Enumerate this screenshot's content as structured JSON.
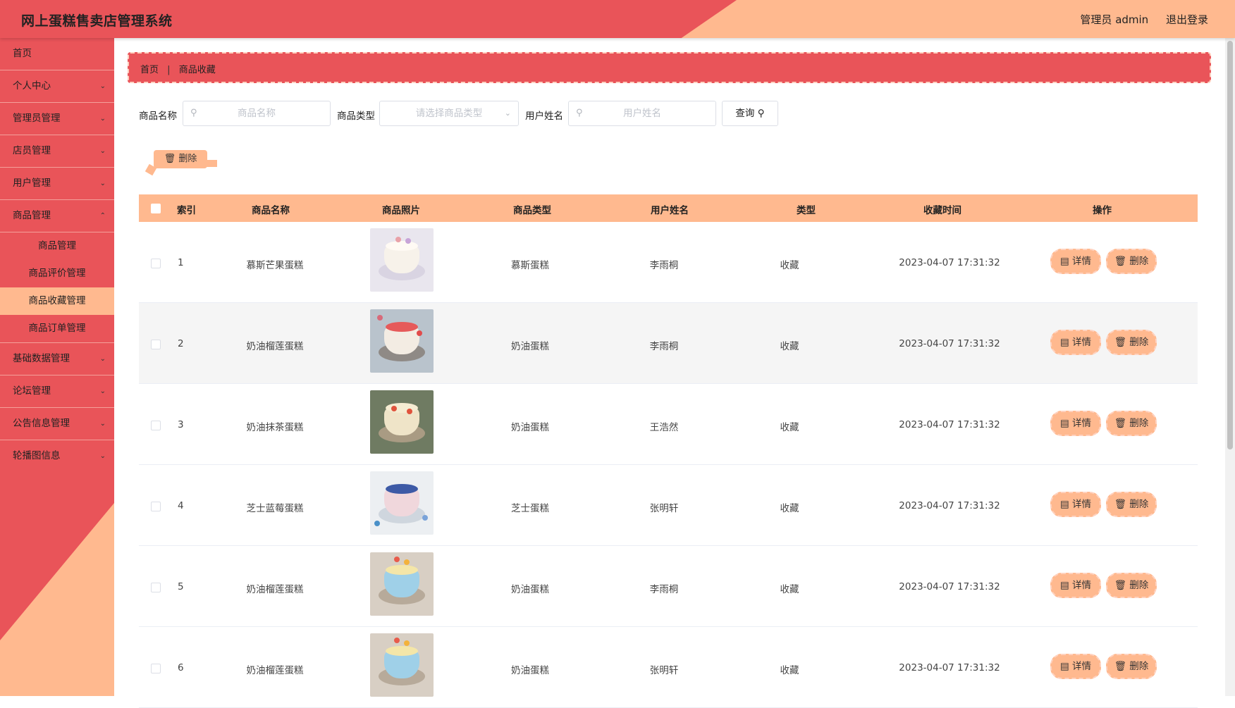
{
  "header": {
    "title": "网上蛋糕售卖店管理系统",
    "user": "管理员 admin",
    "logout": "退出登录"
  },
  "sidebar": {
    "items": [
      {
        "label": "首页"
      },
      {
        "label": "个人中心"
      },
      {
        "label": "管理员管理"
      },
      {
        "label": "店员管理"
      },
      {
        "label": "用户管理"
      },
      {
        "label": "商品管理"
      }
    ],
    "sub_items": [
      {
        "label": "商品管理"
      },
      {
        "label": "商品评价管理"
      },
      {
        "label": "商品收藏管理"
      },
      {
        "label": "商品订单管理"
      }
    ],
    "items_after": [
      {
        "label": "基础数据管理"
      },
      {
        "label": "论坛管理"
      },
      {
        "label": "公告信息管理"
      },
      {
        "label": "轮播图信息"
      }
    ],
    "active_sub": "商品收藏管理"
  },
  "breadcrumb": {
    "home": "首页",
    "current": "商品收藏"
  },
  "search": {
    "name_label": "商品名称",
    "name_placeholder": "商品名称",
    "type_label": "商品类型",
    "type_placeholder": "请选择商品类型",
    "user_label": "用户姓名",
    "user_placeholder": "用户姓名",
    "query": "查询"
  },
  "bulk_delete": "删除",
  "table": {
    "headers": [
      "索引",
      "商品名称",
      "商品照片",
      "商品类型",
      "用户姓名",
      "类型",
      "收藏时间",
      "操作"
    ],
    "rows": [
      {
        "index": "1",
        "name": "慕斯芒果蛋糕",
        "type": "慕斯蛋糕",
        "user": "李雨桐",
        "kind": "收藏",
        "time": "2023-04-07 17:31:32"
      },
      {
        "index": "2",
        "name": "奶油榴莲蛋糕",
        "type": "奶油蛋糕",
        "user": "李雨桐",
        "kind": "收藏",
        "time": "2023-04-07 17:31:32"
      },
      {
        "index": "3",
        "name": "奶油抹茶蛋糕",
        "type": "奶油蛋糕",
        "user": "王浩然",
        "kind": "收藏",
        "time": "2023-04-07 17:31:32"
      },
      {
        "index": "4",
        "name": "芝士蓝莓蛋糕",
        "type": "芝士蛋糕",
        "user": "张明轩",
        "kind": "收藏",
        "time": "2023-04-07 17:31:32"
      },
      {
        "index": "5",
        "name": "奶油榴莲蛋糕",
        "type": "奶油蛋糕",
        "user": "李雨桐",
        "kind": "收藏",
        "time": "2023-04-07 17:31:32"
      },
      {
        "index": "6",
        "name": "奶油榴莲蛋糕",
        "type": "奶油蛋糕",
        "user": "张明轩",
        "kind": "收藏",
        "time": "2023-04-07 17:31:32"
      }
    ],
    "detail_label": "详情",
    "delete_label": "删除"
  },
  "colors": {
    "primary": "#e95459",
    "accent": "#ffb98f"
  }
}
